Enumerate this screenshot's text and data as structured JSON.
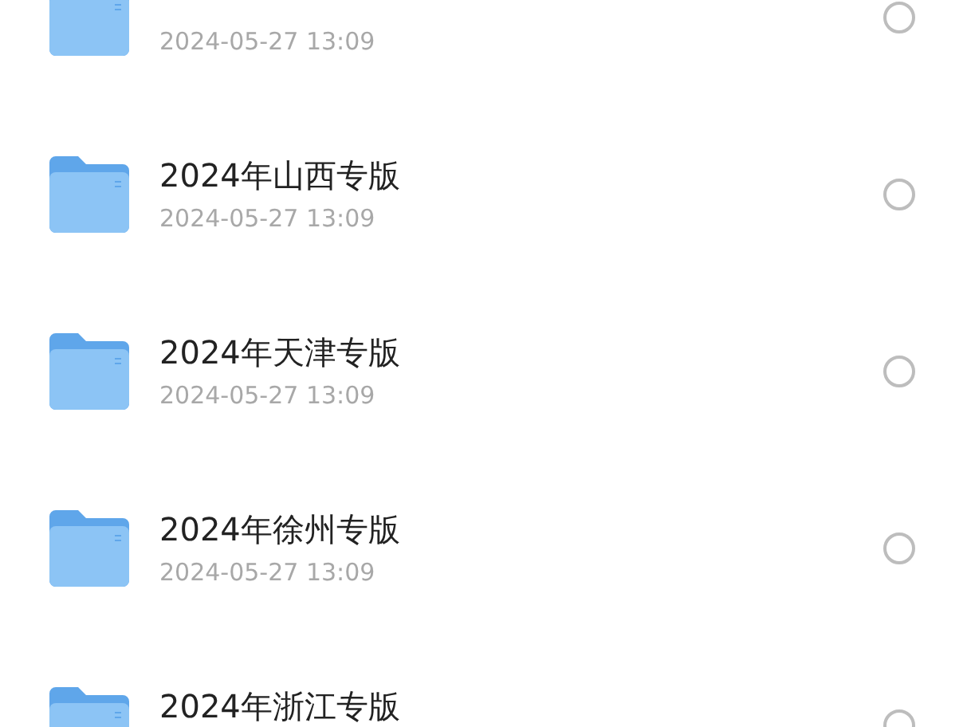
{
  "files": [
    {
      "date": "2024-05-27 13:09",
      "selected": false
    },
    {
      "title": "2024年山西专版",
      "date": "2024-05-27 13:09",
      "selected": false
    },
    {
      "title": "2024年天津专版",
      "date": "2024-05-27 13:09",
      "selected": false
    },
    {
      "title": "2024年徐州专版",
      "date": "2024-05-27 13:09",
      "selected": false
    },
    {
      "title": "2024年浙江专版",
      "selected": false
    }
  ]
}
